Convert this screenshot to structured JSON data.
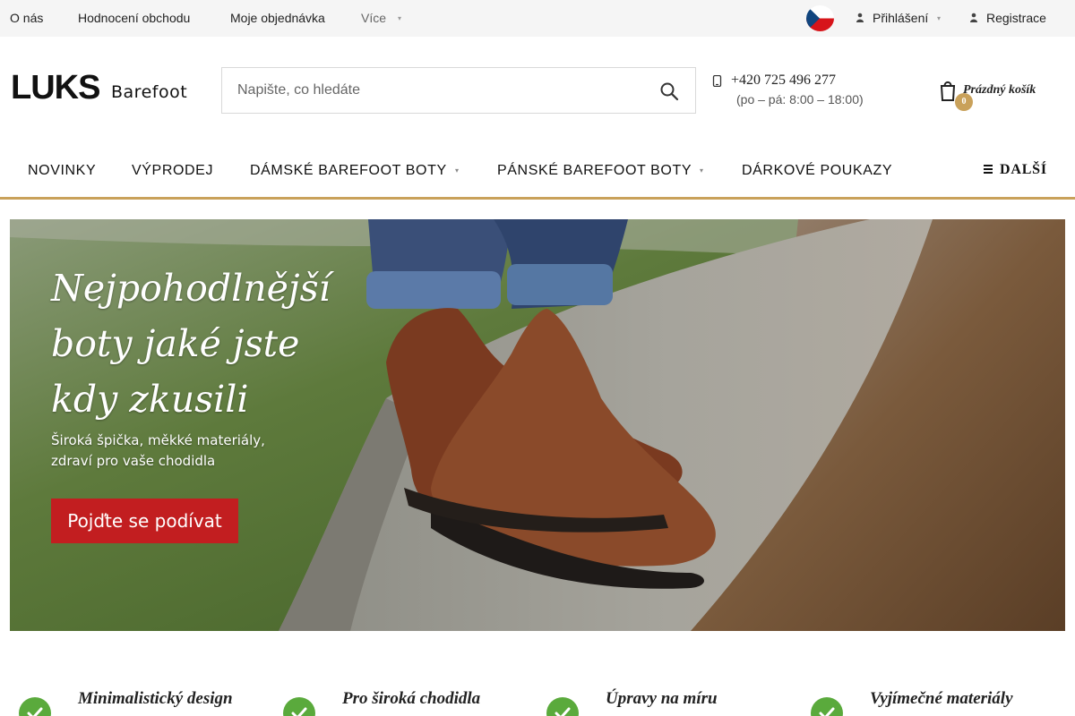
{
  "topbar": {
    "links": [
      "O nás",
      "Hodnocení obchodu",
      "Moje objednávka"
    ],
    "more_label": "Více",
    "login_label": "Přihlášení",
    "register_label": "Registrace"
  },
  "header": {
    "logo_big": "LUKS",
    "logo_small": "Barefoot",
    "search_placeholder": "Napište, co hledáte",
    "phone": "+420 725 496 277",
    "hours": "(po – pá: 8:00 – 18:00)",
    "cart_count": "0",
    "cart_label": "Prázdný košík"
  },
  "nav": {
    "items": [
      "NOVINKY",
      "VÝPRODEJ",
      "DÁMSKÉ BAREFOOT BOTY",
      "PÁNSKÉ BAREFOOT BOTY",
      "DÁRKOVÉ POUKAZY"
    ],
    "more_label": "DALŠÍ"
  },
  "hero": {
    "headline": [
      "Nejpohodlnější",
      "boty jaké jste",
      "kdy zkusili"
    ],
    "subline": [
      "Široká špička, měkké materiály,",
      "zdraví pro vaše chodidla"
    ],
    "cta": "Pojďte se podívat"
  },
  "features": [
    "Minimalistický design",
    "Pro široká chodidla",
    "Úpravy na míru",
    "Vyjímečné materiály"
  ],
  "colors": {
    "accent_gold": "#c9a15a",
    "cta_red": "#c21e20",
    "check_green": "#5aaa3c"
  },
  "icons": {
    "search": "search-icon",
    "phone": "phone-icon",
    "cart": "cart-icon",
    "user": "user-icon",
    "check": "check-icon",
    "menu": "menu-icon",
    "flag": "czech-flag-icon"
  }
}
